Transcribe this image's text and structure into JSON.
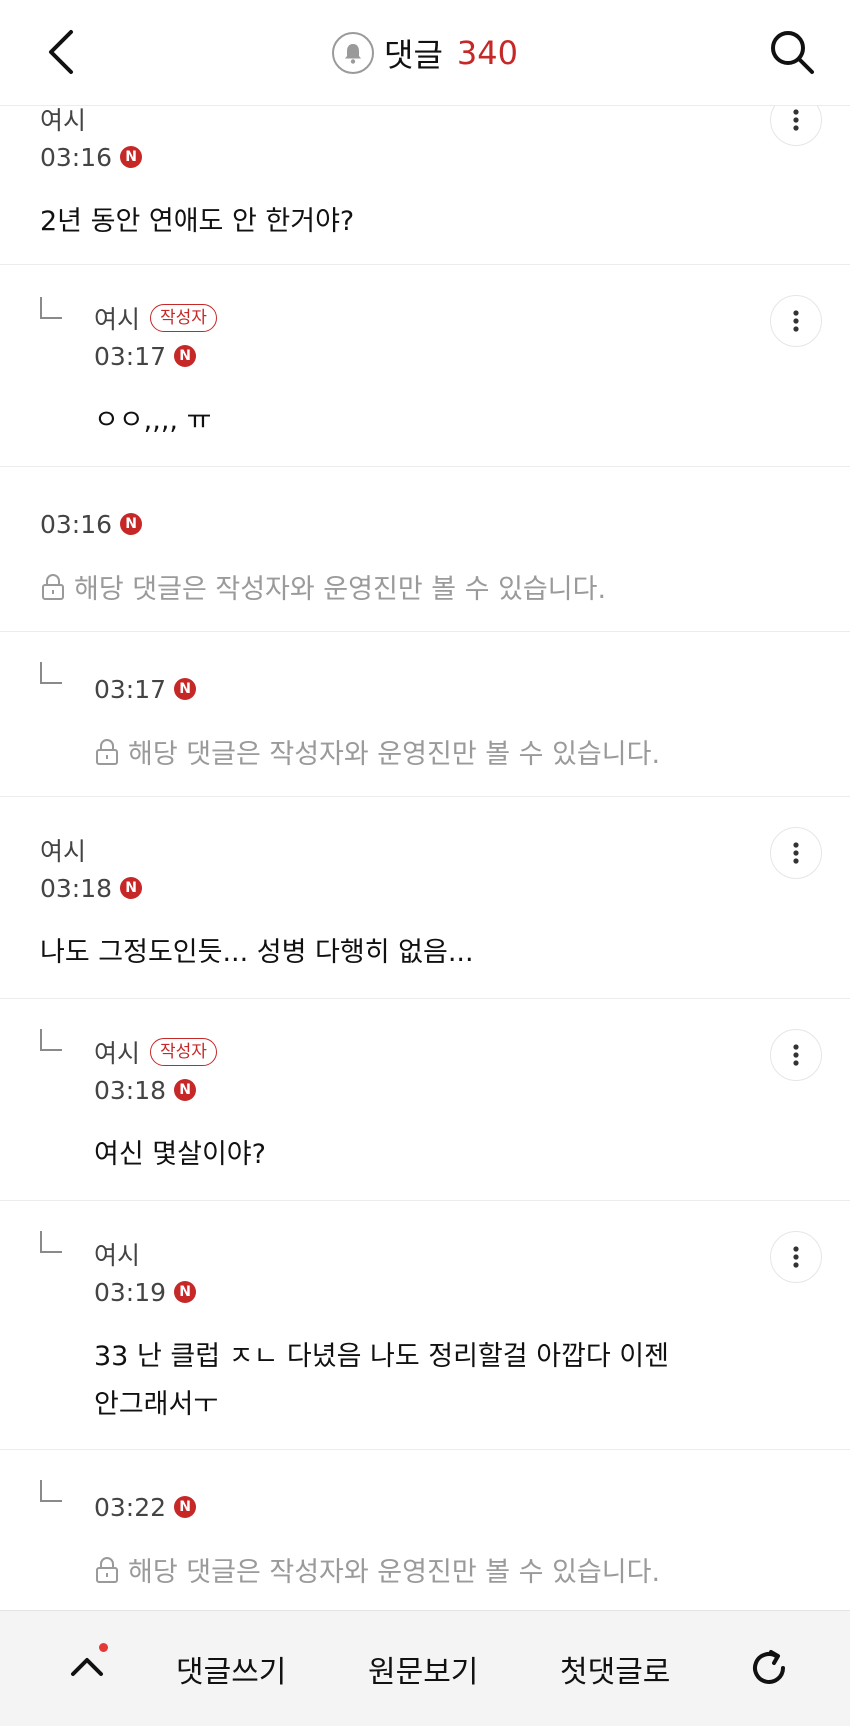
{
  "header": {
    "title": "댓글",
    "count": "340"
  },
  "comments": [
    {
      "reply": false,
      "author": "여시",
      "badge": "",
      "time": "03:16",
      "new_badge": "N",
      "text_lines": [
        "2년 동안 연애도 안 한거야?"
      ],
      "hidden": false
    },
    {
      "reply": true,
      "author": "여시",
      "badge": "작성자",
      "time": "03:17",
      "new_badge": "N",
      "text_lines": [
        "ㅇㅇ,,,, ㅠ"
      ],
      "hidden": false
    },
    {
      "reply": false,
      "author": "",
      "badge": "",
      "time": "03:16",
      "new_badge": "N",
      "text_lines": [],
      "hidden": true,
      "hidden_text": "해당 댓글은 작성자와 운영진만 볼 수 있습니다."
    },
    {
      "reply": true,
      "author": "",
      "badge": "",
      "time": "03:17",
      "new_badge": "N",
      "text_lines": [],
      "hidden": true,
      "hidden_text": "해당 댓글은 작성자와 운영진만 볼 수 있습니다."
    },
    {
      "reply": false,
      "author": "여시",
      "badge": "",
      "time": "03:18",
      "new_badge": "N",
      "text_lines": [
        "나도 그정도인듯... 성병 다행히 없음..."
      ],
      "hidden": false
    },
    {
      "reply": true,
      "author": "여시",
      "badge": "작성자",
      "time": "03:18",
      "new_badge": "N",
      "text_lines": [
        "여신 몇살이야?"
      ],
      "hidden": false
    },
    {
      "reply": true,
      "author": "여시",
      "badge": "",
      "time": "03:19",
      "new_badge": "N",
      "text_lines": [
        "33 난 클럽 ㅈㄴ 다녔음 나도 정리할걸 아깝다 이젠",
        "안그래서ㅜ"
      ],
      "hidden": false
    },
    {
      "reply": true,
      "author": "",
      "badge": "",
      "time": "03:22",
      "new_badge": "N",
      "text_lines": [],
      "hidden": true,
      "hidden_text": "해당 댓글은 작성자와 운영진만 볼 수 있습니다."
    }
  ],
  "bottom_bar": {
    "write_label": "댓글쓰기",
    "original_label": "원문보기",
    "first_label": "첫댓글로"
  },
  "colors": {
    "accent": "#c62828",
    "muted": "#9a9a9a"
  }
}
